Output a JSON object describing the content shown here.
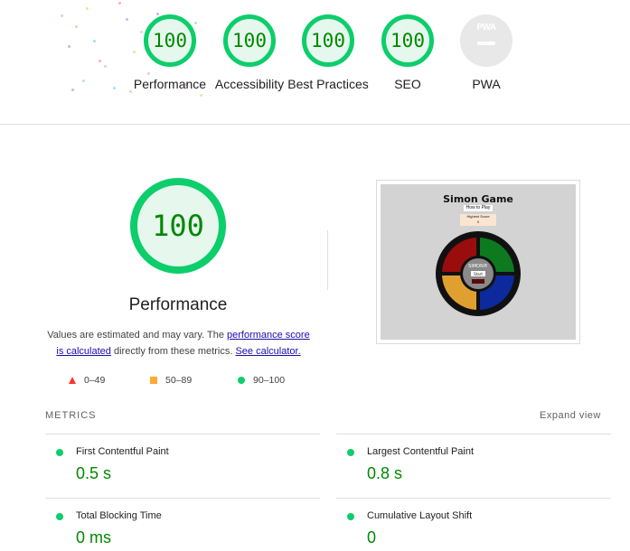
{
  "summary": {
    "gauges": [
      {
        "label": "Performance",
        "score": "100"
      },
      {
        "label": "Accessibility",
        "score": "100"
      },
      {
        "label": "Best Practices",
        "score": "100"
      },
      {
        "label": "SEO",
        "score": "100"
      },
      {
        "label": "PWA",
        "score": null,
        "badge": "PWA"
      }
    ]
  },
  "performance": {
    "score": "100",
    "title": "Performance",
    "desc_prefix": "Values are estimated and may vary. The ",
    "link_score": "performance score is calculated",
    "desc_middle": " directly from these metrics. ",
    "link_calc": "See calculator.",
    "legend": [
      {
        "range": "0–49",
        "shape": "triangle",
        "color": "#ff3333"
      },
      {
        "range": "50–89",
        "shape": "square",
        "color": "#ffaa33"
      },
      {
        "range": "90–100",
        "shape": "circle",
        "color": "#0cce6b"
      }
    ]
  },
  "screenshot": {
    "title": "Simon Game",
    "how_to": "How to Play",
    "score_label": "Highest Score",
    "score_value": "0",
    "center_label": "SIMON®",
    "start_label": "Start"
  },
  "metrics": {
    "header": "METRICS",
    "expand": "Expand view",
    "items": [
      {
        "label": "First Contentful Paint",
        "value": "0.5 s"
      },
      {
        "label": "Largest Contentful Paint",
        "value": "0.8 s"
      },
      {
        "label": "Total Blocking Time",
        "value": "0 ms"
      },
      {
        "label": "Cumulative Layout Shift",
        "value": "0"
      }
    ]
  },
  "colors": {
    "pass": "#0cce6b",
    "pass_text": "#008800",
    "average": "#ffaa33",
    "fail": "#ff3333"
  }
}
